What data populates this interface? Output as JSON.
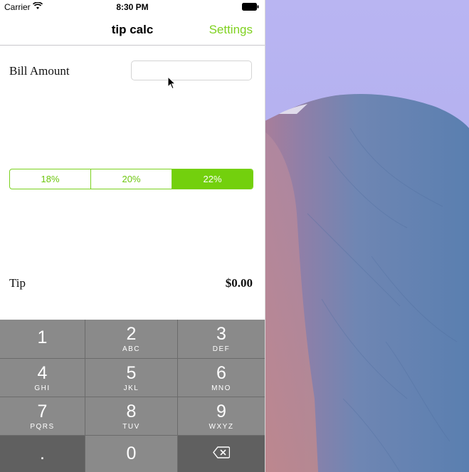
{
  "status_bar": {
    "carrier": "Carrier",
    "time": "8:30 PM"
  },
  "nav": {
    "title": "tip calc",
    "settings_label": "Settings"
  },
  "bill": {
    "label": "Bill Amount",
    "value": "",
    "placeholder": ""
  },
  "tip_options": {
    "items": [
      "18%",
      "20%",
      "22%"
    ],
    "selected": "22%"
  },
  "tip": {
    "label": "Tip",
    "value": "$0.00"
  },
  "keypad": {
    "keys": [
      {
        "digit": "1",
        "letters": ""
      },
      {
        "digit": "2",
        "letters": "ABC"
      },
      {
        "digit": "3",
        "letters": "DEF"
      },
      {
        "digit": "4",
        "letters": "GHI"
      },
      {
        "digit": "5",
        "letters": "JKL"
      },
      {
        "digit": "6",
        "letters": "MNO"
      },
      {
        "digit": "7",
        "letters": "PQRS"
      },
      {
        "digit": "8",
        "letters": "TUV"
      },
      {
        "digit": "9",
        "letters": "WXYZ"
      }
    ],
    "decimal": ".",
    "zero": "0",
    "delete_icon": "backspace-icon"
  },
  "colors": {
    "accent": "#7fd11f",
    "selected_segment": "#73d00d",
    "keypad_key": "#8a8a8a"
  }
}
